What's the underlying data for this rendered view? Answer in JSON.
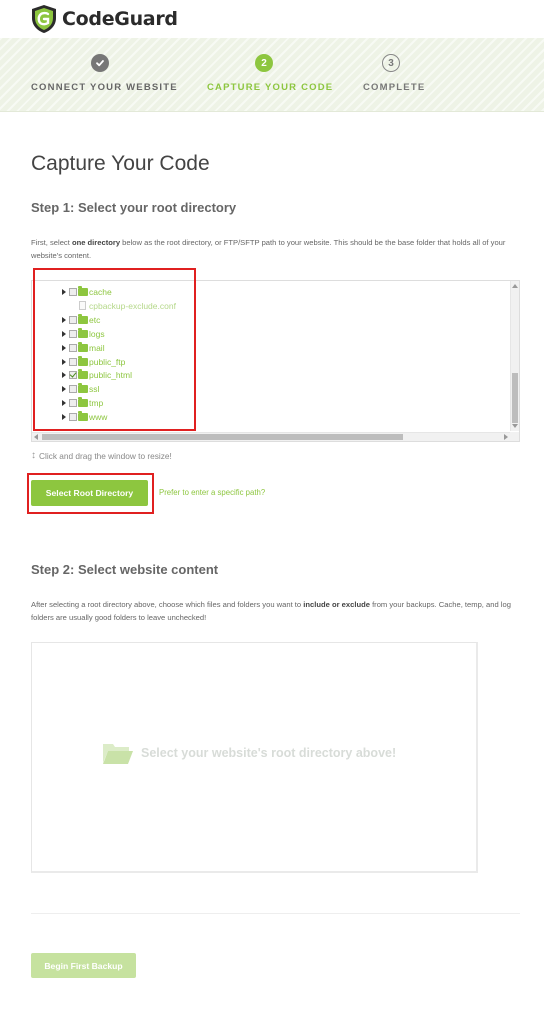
{
  "app": {
    "name": "CodeGuard"
  },
  "colors": {
    "accent": "#8dc63f",
    "highlight": "#e02020",
    "text": "#555555"
  },
  "progress": {
    "steps": [
      {
        "number": "1",
        "label": "CONNECT YOUR WEBSITE",
        "state": "complete",
        "icon": "checkmark-icon"
      },
      {
        "number": "2",
        "label": "CAPTURE YOUR CODE",
        "state": "active"
      },
      {
        "number": "3",
        "label": "COMPLETE",
        "state": "pending"
      }
    ]
  },
  "page": {
    "title": "Capture Your Code"
  },
  "step1": {
    "heading": "Step 1: Select your root directory",
    "description_pre": "First, select ",
    "description_bold": "one directory",
    "description_post": " below as the root directory, or FTP/SFTP path to your website. This should be the base folder that holds all of your website's content.",
    "tree": [
      {
        "name": "cache",
        "type": "folder",
        "checked": false
      },
      {
        "name": "cpbackup-exclude.conf",
        "type": "file",
        "checked": false
      },
      {
        "name": "etc",
        "type": "folder",
        "checked": false
      },
      {
        "name": "logs",
        "type": "folder",
        "checked": false
      },
      {
        "name": "mail",
        "type": "folder",
        "checked": false
      },
      {
        "name": "public_ftp",
        "type": "folder",
        "checked": false
      },
      {
        "name": "public_html",
        "type": "folder",
        "checked": true
      },
      {
        "name": "ssl",
        "type": "folder",
        "checked": false
      },
      {
        "name": "tmp",
        "type": "folder",
        "checked": false
      },
      {
        "name": "www",
        "type": "folder",
        "checked": false
      }
    ],
    "resize_hint": "Click and drag the window to resize!",
    "select_button": "Select Root Directory",
    "path_link": "Prefer to enter a specific path?"
  },
  "step2": {
    "heading": "Step 2: Select website content",
    "description_pre": "After selecting a root directory above, choose which files and folders you want to ",
    "description_bold": "include or exclude",
    "description_post": " from your backups. Cache, temp, and log folders are usually good folders to leave unchecked!",
    "placeholder": "Select your website's root directory above!"
  },
  "footer": {
    "begin_button": "Begin First Backup"
  }
}
